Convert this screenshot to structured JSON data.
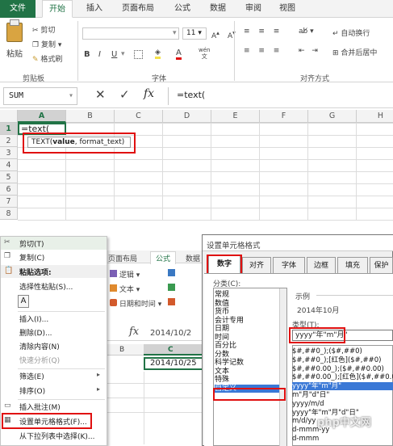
{
  "ribbon": {
    "tabs": [
      "文件",
      "开始",
      "插入",
      "页面布局",
      "公式",
      "数据",
      "审阅",
      "视图"
    ],
    "clipboard": {
      "paste": "粘贴",
      "cut": "剪切",
      "copy": "复制",
      "format_painter": "格式刷",
      "group": "剪贴板"
    },
    "font": {
      "size": "11",
      "bold": "B",
      "italic": "I",
      "underline": "U",
      "group": "字体",
      "wen": "wén"
    },
    "align": {
      "wrap": "自动换行",
      "merge": "合并后居中",
      "group": "对齐方式"
    }
  },
  "formula_bar": {
    "name_box": "SUM",
    "cancel": "✕",
    "enter": "✓",
    "fx": "fx",
    "content": "=text("
  },
  "grid": {
    "columns": [
      "A",
      "B",
      "C",
      "D",
      "E",
      "F",
      "G",
      "H"
    ],
    "rows": [
      "1",
      "2",
      "3",
      "4",
      "5",
      "6",
      "7",
      "8"
    ],
    "a1": "=text(",
    "tooltip_fn": "TEXT(",
    "tooltip_arg1": "value",
    "tooltip_rest": ", format_text)"
  },
  "context_menu": {
    "items": [
      "剪切(T)",
      "复制(C)",
      "粘贴选项:",
      "选择性粘贴(S)...",
      "插入(I)...",
      "删除(D)...",
      "清除内容(N)",
      "快速分析(Q)",
      "筛选(E)",
      "排序(O)",
      "插入批注(M)",
      "设置单元格格式(F)...",
      "从下拉列表中选择(K)..."
    ]
  },
  "bg_ribbon": {
    "tab1": "页面布局",
    "tab2": "公式",
    "tab3": "数据",
    "btn1": "逻辑",
    "btn2": "文本",
    "btn3": "日期和时间",
    "fx": "fx",
    "cell_ref": "2014/10/2",
    "col_b": "B",
    "col_c": "C",
    "cell_c": "2014/10/25"
  },
  "dialog": {
    "title": "设置单元格格式",
    "tabs": [
      "数字",
      "对齐",
      "字体",
      "边框",
      "填充",
      "保护"
    ],
    "category_label": "分类(C):",
    "categories": [
      "常规",
      "数值",
      "货币",
      "会计专用",
      "日期",
      "时间",
      "百分比",
      "分数",
      "科学记数",
      "文本",
      "特殊",
      "自定义"
    ],
    "sample_label": "示例",
    "sample_value": "2014年10月",
    "type_label": "类型(T):",
    "type_value": "yyyy\"年\"m\"月\"",
    "formats": [
      "$#,##0_);($#,##0)",
      "$#,##0_);[红色]($#,##0)",
      "$#,##0.00_);($#,##0.00)",
      "$#,##0.00_);[红色]($#,##0.00)",
      "yyyy\"年\"m\"月\"",
      "m\"月\"d\"日\"",
      "yyyy/m/d",
      "yyyy\"年\"m\"月\"d\"日\"",
      "m/d/yy",
      "d-mmm-yy",
      "d-mmm"
    ]
  },
  "watermark": "php中文网"
}
